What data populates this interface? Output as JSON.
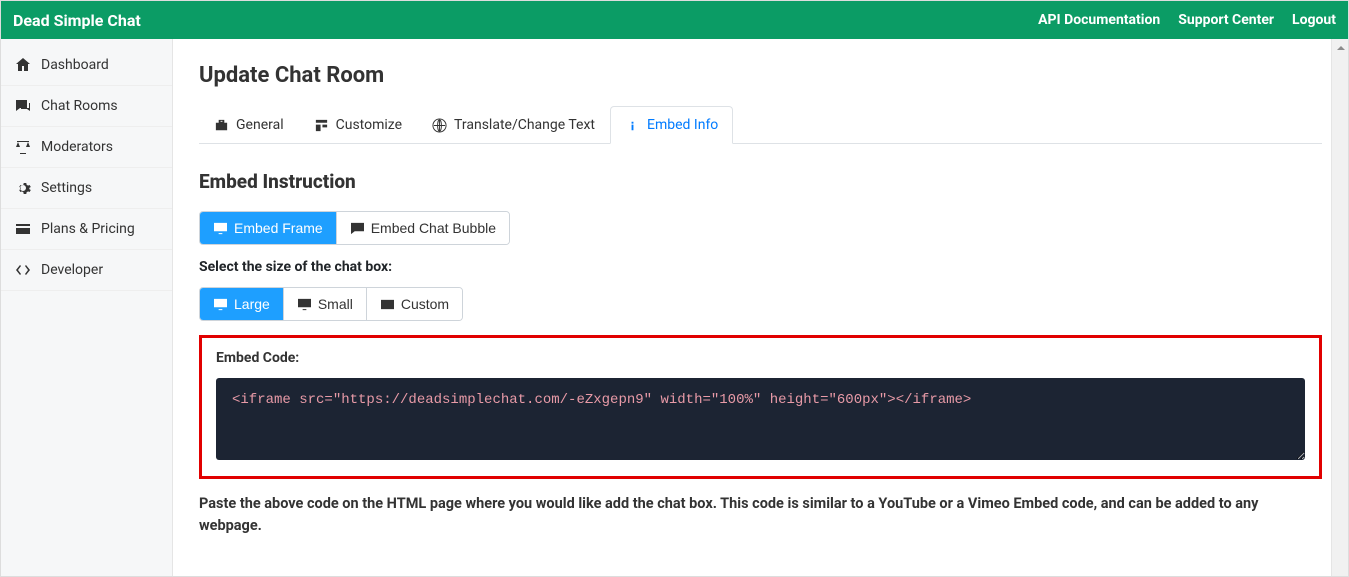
{
  "header": {
    "brand": "Dead Simple Chat",
    "links": [
      "API Documentation",
      "Support Center",
      "Logout"
    ]
  },
  "sidebar": {
    "items": [
      {
        "label": "Dashboard"
      },
      {
        "label": "Chat Rooms"
      },
      {
        "label": "Moderators"
      },
      {
        "label": "Settings"
      },
      {
        "label": "Plans & Pricing"
      },
      {
        "label": "Developer"
      }
    ]
  },
  "page": {
    "title": "Update Chat Room",
    "tabs": [
      {
        "label": "General"
      },
      {
        "label": "Customize"
      },
      {
        "label": "Translate/Change Text"
      },
      {
        "label": "Embed Info"
      }
    ],
    "section_title": "Embed Instruction",
    "embed_type": {
      "frame": "Embed Frame",
      "bubble": "Embed Chat Bubble"
    },
    "size_label": "Select the size of the chat box:",
    "sizes": {
      "large": "Large",
      "small": "Small",
      "custom": "Custom"
    },
    "code_label": "Embed Code:",
    "code_value": "<iframe src=\"https://deadsimplechat.com/-eZxgepn9\" width=\"100%\" height=\"600px\"></iframe>",
    "instruction": "Paste the above code on the HTML page where you would like add the chat box. This code is similar to a YouTube or a Vimeo Embed code, and can be added to any webpage."
  }
}
